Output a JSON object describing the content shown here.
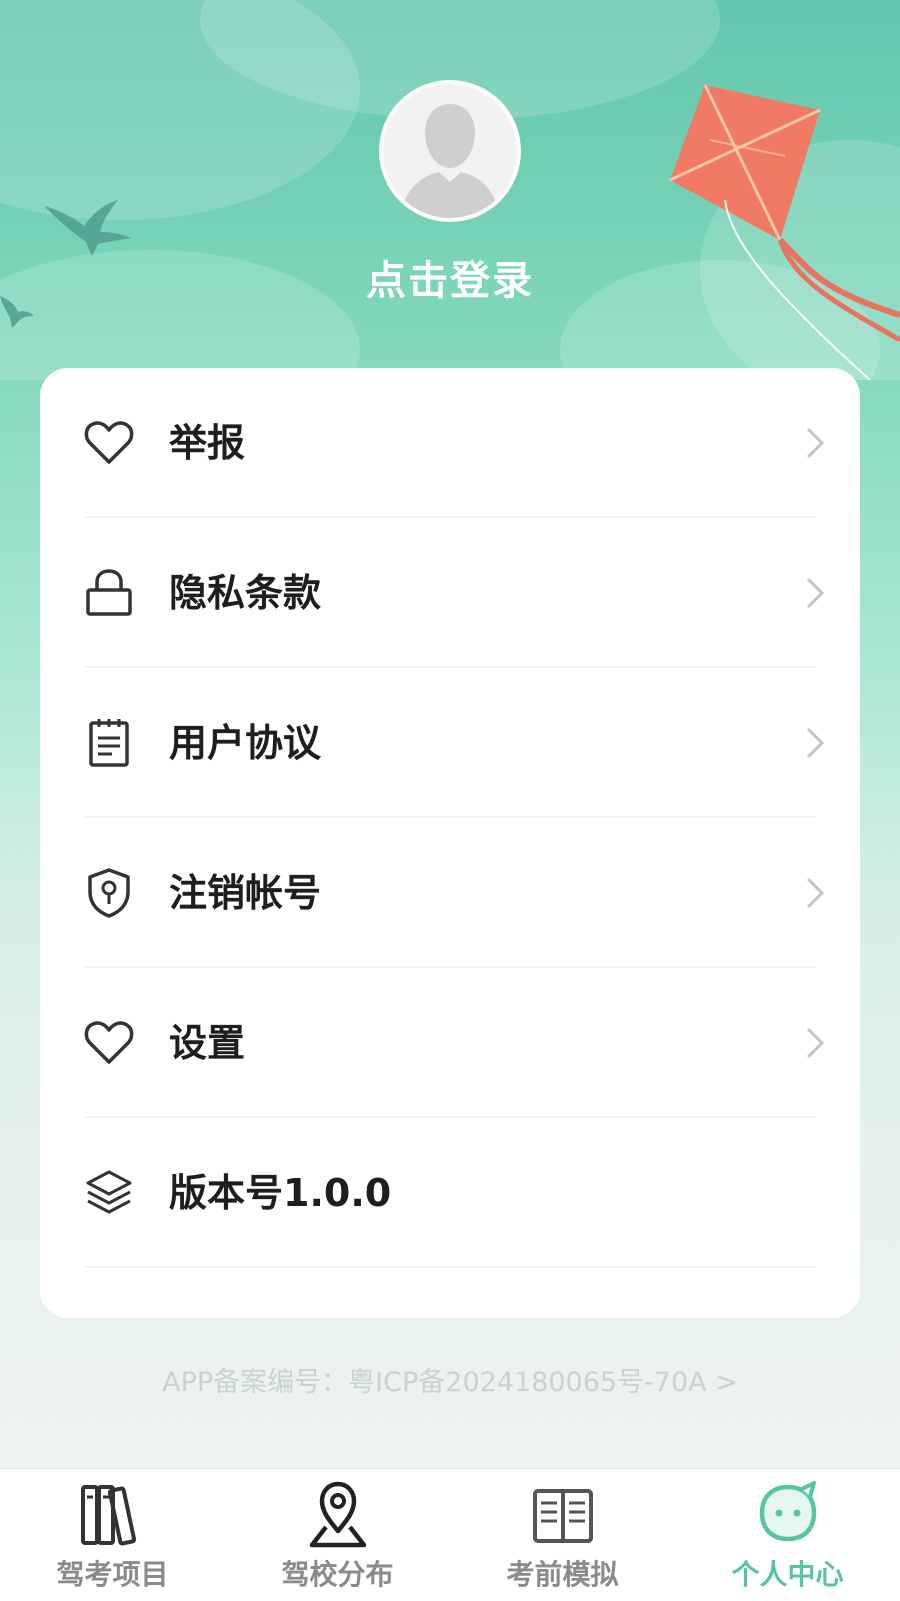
{
  "profile": {
    "login_text": "点击登录"
  },
  "menu": {
    "items": [
      {
        "label": "举报",
        "icon": "heart-icon"
      },
      {
        "label": "隐私条款",
        "icon": "lock-icon"
      },
      {
        "label": "用户协议",
        "icon": "notepad-icon"
      },
      {
        "label": "注销帐号",
        "icon": "shield-key-icon"
      },
      {
        "label": "设置",
        "icon": "heart-icon"
      },
      {
        "label": "版本号1.0.0",
        "icon": "layers-icon"
      }
    ]
  },
  "footer": {
    "icp_text": "APP备案编号：粤ICP备2024180065号-70A >"
  },
  "tabbar": {
    "items": [
      {
        "label": "驾考项目",
        "icon": "books-icon"
      },
      {
        "label": "驾校分布",
        "icon": "map-pin-icon"
      },
      {
        "label": "考前模拟",
        "icon": "open-book-icon"
      },
      {
        "label": "个人中心",
        "icon": "face-icon",
        "active": true
      }
    ]
  },
  "colors": {
    "accent": "#58c4a4",
    "header_top": "#63c7ad",
    "kite": "#f07a64"
  }
}
